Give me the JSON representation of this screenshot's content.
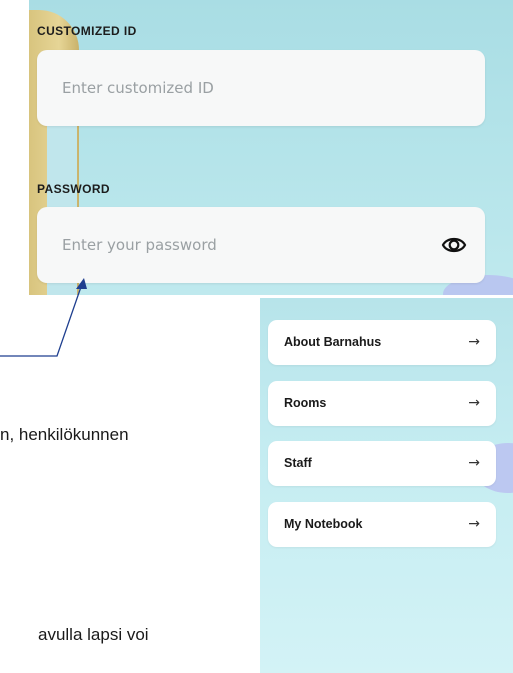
{
  "login": {
    "customized_id": {
      "label": "CUSTOMIZED ID",
      "placeholder": "Enter customized ID"
    },
    "password": {
      "label": "PASSWORD",
      "placeholder": "Enter your password"
    },
    "visibility_icon": "eye-icon"
  },
  "menu": {
    "items": [
      {
        "label": "About Barnahus",
        "icon": "arrow-right-icon"
      },
      {
        "label": "Rooms",
        "icon": "arrow-right-icon"
      },
      {
        "label": "Staff",
        "icon": "arrow-right-icon"
      },
      {
        "label": "My Notebook",
        "icon": "arrow-right-icon"
      }
    ],
    "arrow_glyph": "→"
  },
  "document": {
    "line_1_fragment": "n, henkilökunnen",
    "line_2_fragment": "avulla lapsi voi"
  },
  "colors": {
    "callout_line": "#1f3f8f"
  }
}
